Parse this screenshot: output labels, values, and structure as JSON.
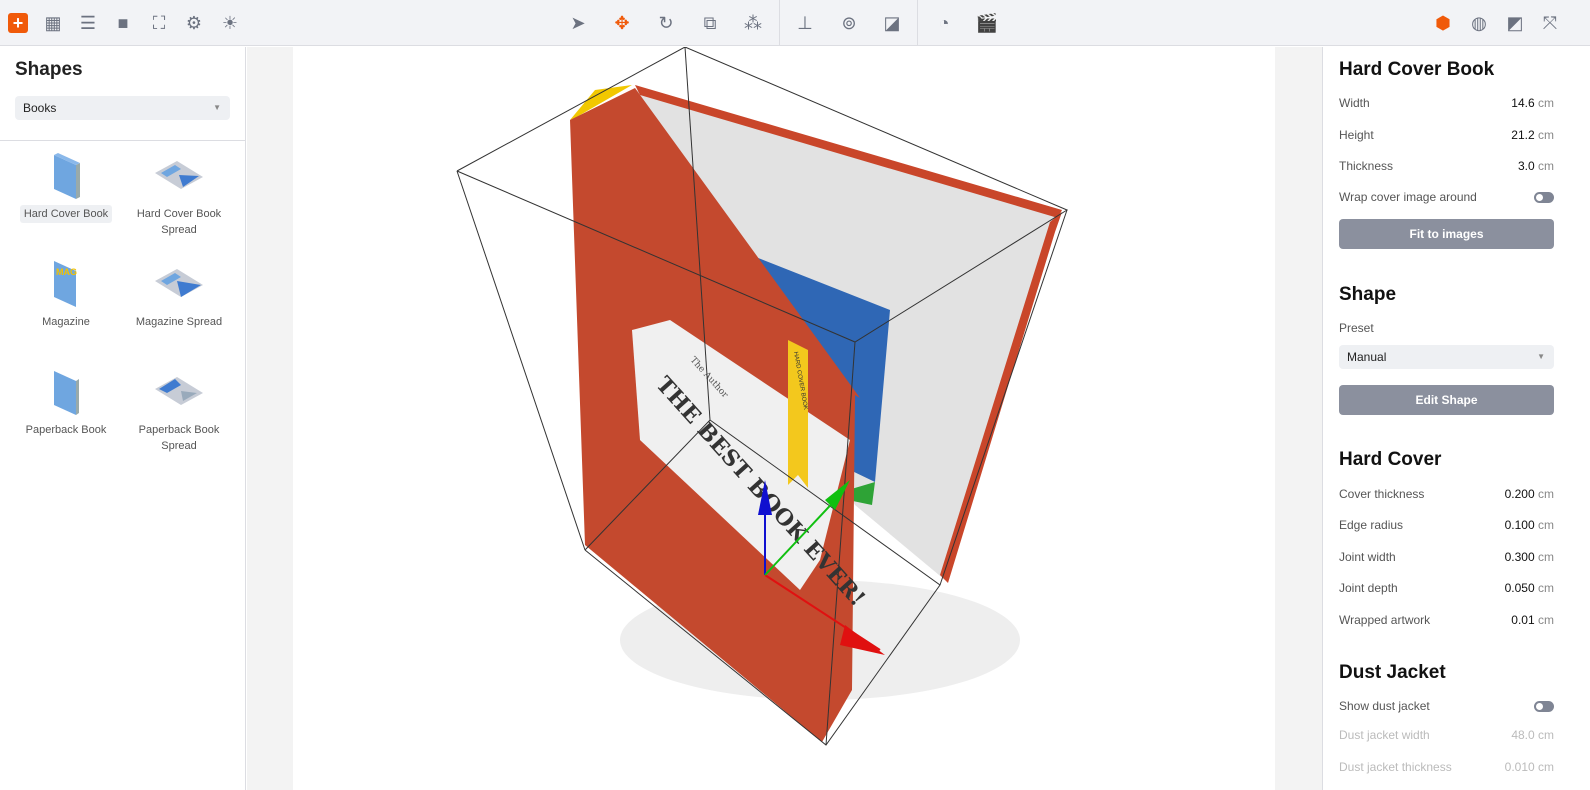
{
  "toolbar": {
    "left_icons": [
      "add-icon",
      "grid-icon",
      "list-icon",
      "camera-icon",
      "focus-icon",
      "gear-icon",
      "light-icon"
    ],
    "center_icons": [
      "select-icon",
      "move-icon",
      "rotate-icon",
      "scale-icon",
      "axes-icon",
      "floor-icon",
      "inspect-icon",
      "material-icon",
      "timer-icon",
      "clapper-icon"
    ],
    "right_icons": [
      "cube-icon",
      "texture-icon",
      "frame-icon",
      "fullscreen-icon"
    ],
    "accent": "#f05a0a"
  },
  "left": {
    "title": "Shapes",
    "category": "Books",
    "items": [
      {
        "label": "Hard Cover Book",
        "selected": true
      },
      {
        "label": "Hard Cover Book Spread"
      },
      {
        "label": "Magazine",
        "cover_text": "MAG"
      },
      {
        "label": "Magazine Spread"
      },
      {
        "label": "Paperback Book"
      },
      {
        "label": "Paperback Book Spread"
      }
    ]
  },
  "viewport": {
    "cover_title": "THE BEST BOOK EVER!",
    "cover_subtitle": "The Author",
    "bookmark_text": "HARD COVER BOOK"
  },
  "right": {
    "title": "Hard Cover Book",
    "dims": [
      {
        "label": "Width",
        "value": "14.6",
        "unit": "cm"
      },
      {
        "label": "Height",
        "value": "21.2",
        "unit": "cm"
      },
      {
        "label": "Thickness",
        "value": "3.0",
        "unit": "cm"
      }
    ],
    "wrap_label": "Wrap cover image around",
    "wrap_on": false,
    "fit_button": "Fit to images",
    "shape_title": "Shape",
    "preset_label": "Preset",
    "preset_value": "Manual",
    "edit_button": "Edit Shape",
    "hard_cover_title": "Hard Cover",
    "hard_cover": [
      {
        "label": "Cover thickness",
        "value": "0.200",
        "unit": "cm"
      },
      {
        "label": "Edge radius",
        "value": "0.100",
        "unit": "cm"
      },
      {
        "label": "Joint width",
        "value": "0.300",
        "unit": "cm"
      },
      {
        "label": "Joint depth",
        "value": "0.050",
        "unit": "cm"
      },
      {
        "label": "Wrapped artwork",
        "value": "0.01",
        "unit": "cm"
      }
    ],
    "dust_title": "Dust Jacket",
    "dust_show_label": "Show dust jacket",
    "dust_on": false,
    "dust": [
      {
        "label": "Dust jacket width",
        "value": "48.0 cm"
      },
      {
        "label": "Dust jacket thickness",
        "value": "0.010 cm"
      }
    ]
  }
}
